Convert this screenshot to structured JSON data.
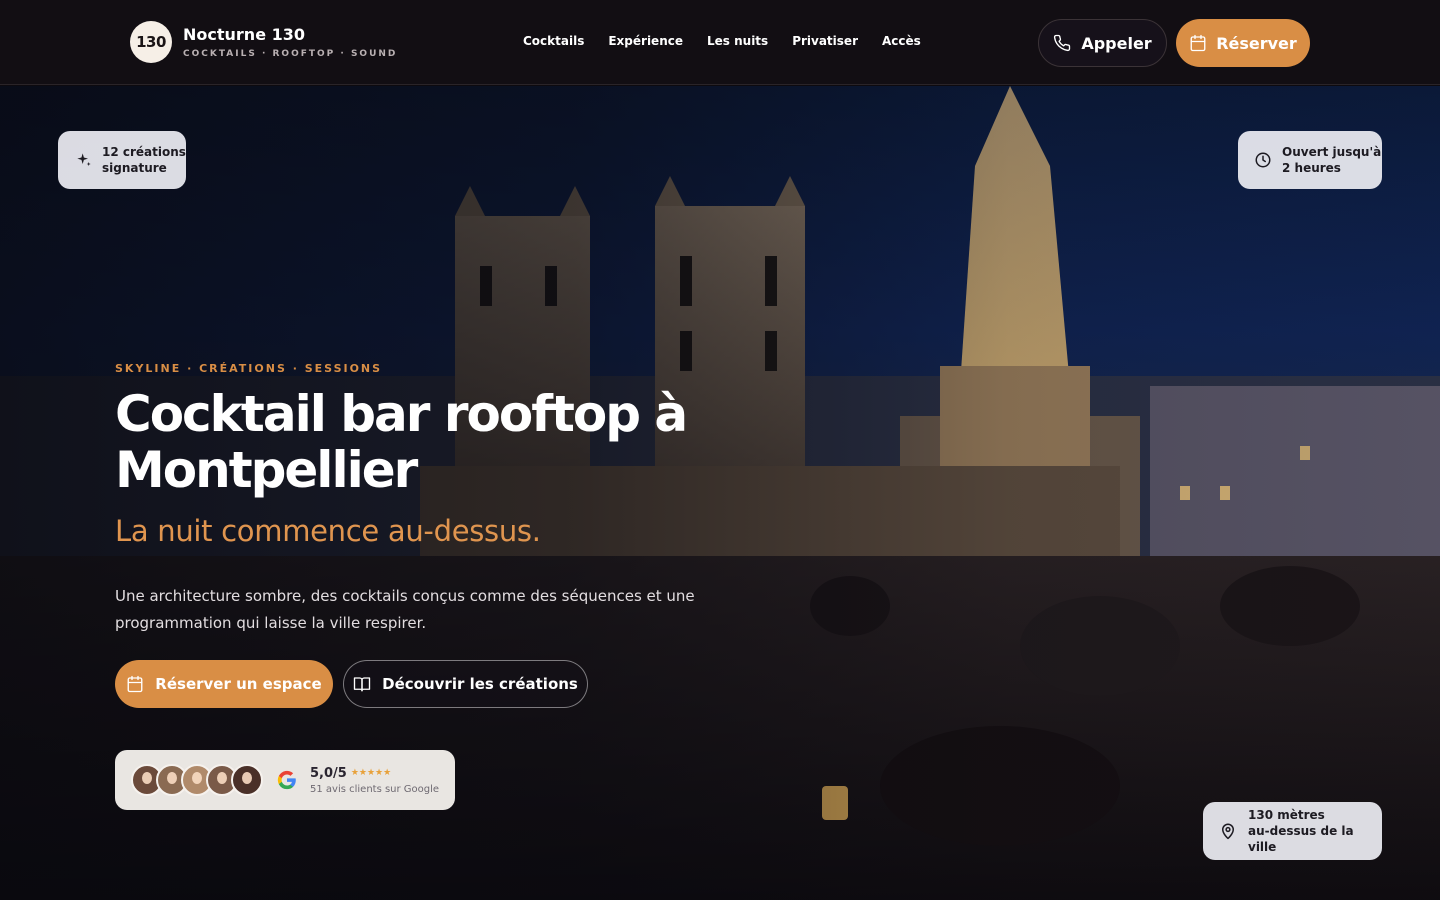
{
  "brand": {
    "logo_text": "130",
    "name": "Nocturne 130",
    "tagline": "COCKTAILS · ROOFTOP · SOUND"
  },
  "nav": {
    "items": [
      {
        "label": "Cocktails"
      },
      {
        "label": "Expérience"
      },
      {
        "label": "Les nuits"
      },
      {
        "label": "Privatiser"
      },
      {
        "label": "Accès"
      }
    ]
  },
  "header_actions": {
    "call_label": "Appeler",
    "reserve_label": "Réserver"
  },
  "hero": {
    "chips": {
      "creations_line1": "12 créations",
      "creations_line2": "signature",
      "hours_line1": "Ouvert jusqu'à",
      "hours_line2": "2 heures",
      "height_line1": "130 mètres",
      "height_line2": "au-dessus de la ville"
    },
    "kicker": "SKYLINE · CRÉATIONS · SESSIONS",
    "title": "Cocktail bar rooftop à Montpellier",
    "subtitle": "La nuit commence au-dessus.",
    "lead": "Une architecture sombre, des cocktails conçus comme des séquences et une programmation qui laisse la ville respirer.",
    "primary_cta": "Réserver un espace",
    "secondary_cta": "Découvrir les créations",
    "reviews": {
      "score": "5,0/5",
      "stars": "★★★★★",
      "count": "51 avis clients sur Google"
    }
  },
  "colors": {
    "accent": "#d98e45",
    "header_bg": "#120e13",
    "sky": "#102454"
  },
  "icons": {
    "chip_creations": "sparkle-icon",
    "chip_hours": "clock-icon",
    "chip_height": "map-pin-icon",
    "call": "phone-icon",
    "reserve": "calendar-icon",
    "discover": "book-icon",
    "reviews": "google-icon"
  }
}
